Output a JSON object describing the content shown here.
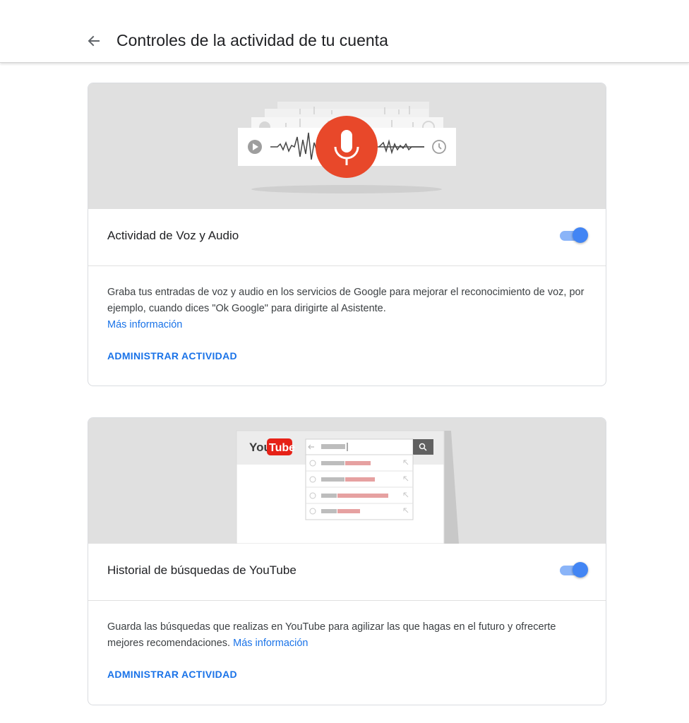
{
  "header": {
    "title": "Controles de la actividad de tu cuenta",
    "back_icon": "arrow-back-icon"
  },
  "cards": [
    {
      "heading": "Actividad de Voz y Audio",
      "toggle_on": true,
      "description": "Graba tus entradas de voz y audio en los servicios de Google para mejorar el reconocimiento de voz, por ejemplo, cuando dices \"Ok Google\" para dirigirte al Asistente.",
      "more_info": "Más información",
      "manage": "ADMINISTRAR ACTIVIDAD",
      "illustration_icon": "microphone-icon"
    },
    {
      "heading": "Historial de búsquedas de YouTube",
      "toggle_on": true,
      "description": "Guarda las búsquedas que realizas en YouTube para agilizar las que hagas en el futuro y ofrecerte mejores recomendaciones.",
      "more_info": "Más información",
      "manage": "ADMINISTRAR ACTIVIDAD",
      "logo_you": "You",
      "logo_tube": "Tube",
      "illustration_icon": "search-icon"
    }
  ],
  "colors": {
    "accent": "#1a73e8",
    "toggle": "#4285f4",
    "mic": "#e8482a",
    "youtube_red": "#e62117"
  }
}
